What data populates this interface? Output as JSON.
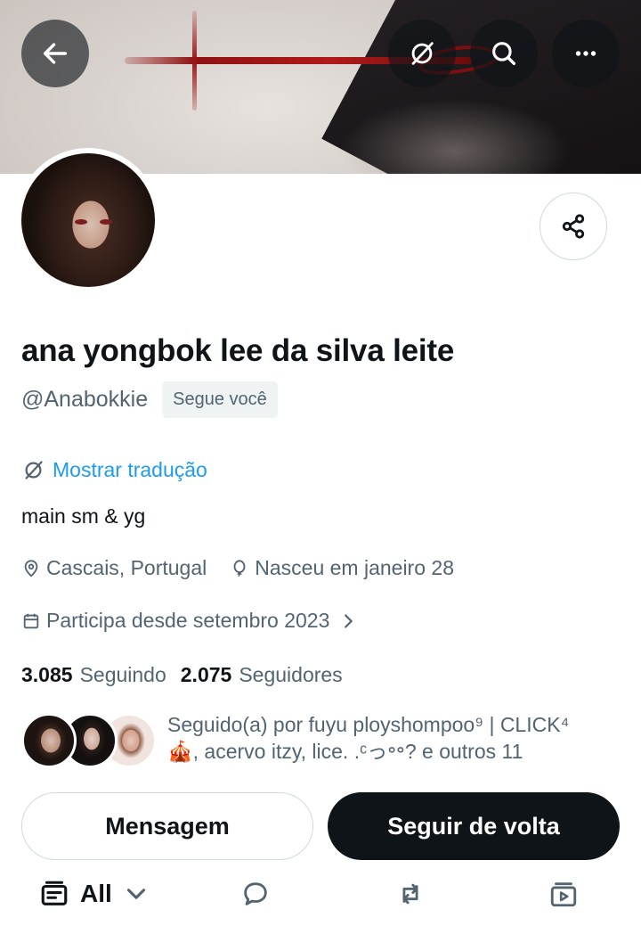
{
  "header": {
    "back_icon": "arrow-left-icon",
    "translate_icon": "translate-off-icon",
    "search_icon": "search-icon",
    "more_icon": "more-horizontal-icon"
  },
  "profile": {
    "display_name": "ana yongbok lee da silva leite",
    "handle": "@Anabokkie",
    "follows_you_badge": "Segue você",
    "translate_label": "Mostrar tradução",
    "bio": "main sm & yg",
    "location": "Cascais, Portugal",
    "birthday": "Nasceu em janeiro 28",
    "joined": "Participa desde setembro 2023"
  },
  "stats": {
    "following_count": "3.085",
    "following_label": "Seguindo",
    "followers_count": "2.075",
    "followers_label": "Seguidores"
  },
  "followed_by": {
    "text": "Seguido(a) por fuyu ployshompoo⁹ | CLICK⁴ 🎪, acervo itzy, lice. .ᶜっ॰॰? e outros 11"
  },
  "actions": {
    "message_label": "Mensagem",
    "follow_back_label": "Seguir de volta"
  },
  "tabs": {
    "all_label": "All"
  },
  "colors": {
    "accent": "#1d9bf0",
    "text_primary": "#0f1419",
    "text_secondary": "#536471",
    "border": "#cfd9de"
  }
}
